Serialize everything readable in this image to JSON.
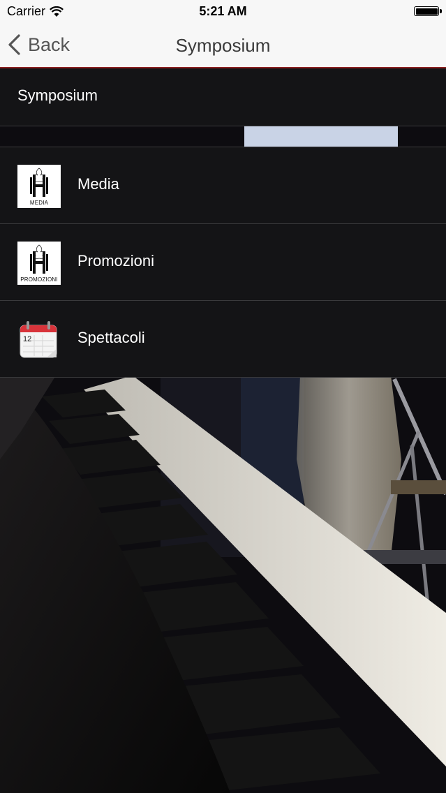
{
  "status_bar": {
    "carrier": "Carrier",
    "time": "5:21 AM"
  },
  "nav": {
    "back_label": "Back",
    "title": "Symposium"
  },
  "header": {
    "title": "Symposium"
  },
  "menu": {
    "items": [
      {
        "label": "Media",
        "icon": "media-logo-icon",
        "icon_caption": "MEDIA"
      },
      {
        "label": "Promozioni",
        "icon": "promozioni-logo-icon",
        "icon_caption": "PROMOZIONI"
      },
      {
        "label": "Spettacoli",
        "icon": "calendar-icon",
        "icon_caption": "12"
      }
    ]
  },
  "colors": {
    "nav_background": "#f7f7f7",
    "nav_divider": "#8a2020",
    "list_background": "#141416",
    "text": "#ffffff",
    "separator": "#3a3a3c"
  }
}
